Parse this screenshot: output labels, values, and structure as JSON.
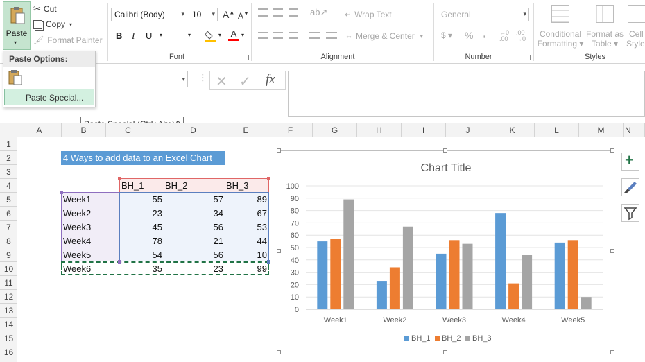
{
  "ribbon": {
    "clipboard": {
      "paste_label": "Paste",
      "cut_label": "Cut",
      "copy_label": "Copy",
      "format_painter_label": "Format Painter"
    },
    "font": {
      "group_label": "Font",
      "font_name": "Calibri (Body)",
      "font_size": "10",
      "bold": "B",
      "italic": "I",
      "underline": "U",
      "grow": "A",
      "shrink": "A"
    },
    "alignment": {
      "group_label": "Alignment",
      "wrap_text_label": "Wrap Text",
      "merge_center_label": "Merge & Center"
    },
    "number": {
      "group_label": "Number",
      "format": "General",
      "percent": "%",
      "comma": ","
    },
    "styles": {
      "group_label": "Styles",
      "conditional_formatting": [
        "Conditional",
        "Formatting"
      ],
      "format_as_table": [
        "Format as",
        "Table"
      ],
      "cell_styles": [
        "Cell",
        "Styles"
      ]
    }
  },
  "paste_menu": {
    "header": "Paste Options:",
    "paste_special_label": "Paste Special..."
  },
  "tooltip": "Paste Special (Ctrl+Alt+V)",
  "formula_bar": {
    "fx_label": "fx",
    "content": ""
  },
  "columns": [
    "A",
    "B",
    "C",
    "D",
    "E",
    "F",
    "G",
    "H",
    "I",
    "J",
    "K",
    "L",
    "M",
    "N"
  ],
  "rows": [
    "1",
    "2",
    "3",
    "4",
    "5",
    "6",
    "7",
    "8",
    "9",
    "10",
    "11",
    "12",
    "13",
    "14",
    "15",
    "16"
  ],
  "sheet": {
    "title_text": "4 Ways to add data to an Excel Chart",
    "headers": [
      "BH_1",
      "BH_2",
      "BH_3"
    ],
    "data": [
      {
        "label": "Week1",
        "v1": "55",
        "v2": "57",
        "v3": "89"
      },
      {
        "label": "Week2",
        "v1": "23",
        "v2": "34",
        "v3": "67"
      },
      {
        "label": "Week3",
        "v1": "45",
        "v2": "56",
        "v3": "53"
      },
      {
        "label": "Week4",
        "v1": "78",
        "v2": "21",
        "v3": "44"
      },
      {
        "label": "Week5",
        "v1": "54",
        "v2": "56",
        "v3": "10"
      },
      {
        "label": "Week6",
        "v1": "35",
        "v2": "23",
        "v3": "99"
      }
    ]
  },
  "colors": {
    "bh1": "#5b9bd5",
    "bh2": "#ed7d31",
    "bh3": "#a5a5a5",
    "accent_green": "#217346",
    "title_fill": "#5b9bd5"
  },
  "chart_data": {
    "type": "bar",
    "title": "Chart Title",
    "categories": [
      "Week1",
      "Week2",
      "Week3",
      "Week4",
      "Week5"
    ],
    "series": [
      {
        "name": "BH_1",
        "values": [
          55,
          23,
          45,
          78,
          54
        ]
      },
      {
        "name": "BH_2",
        "values": [
          57,
          34,
          56,
          21,
          56
        ]
      },
      {
        "name": "BH_3",
        "values": [
          89,
          67,
          53,
          44,
          10
        ]
      }
    ],
    "ylim": [
      0,
      100
    ],
    "yticks": [
      "0",
      "10",
      "20",
      "30",
      "40",
      "50",
      "60",
      "70",
      "80",
      "90",
      "100"
    ],
    "xlabel": "",
    "ylabel": "",
    "grid": true,
    "legend": "bottom"
  },
  "chart_buttons": {
    "add_element": "+",
    "styles": "brush",
    "filter": "funnel"
  }
}
